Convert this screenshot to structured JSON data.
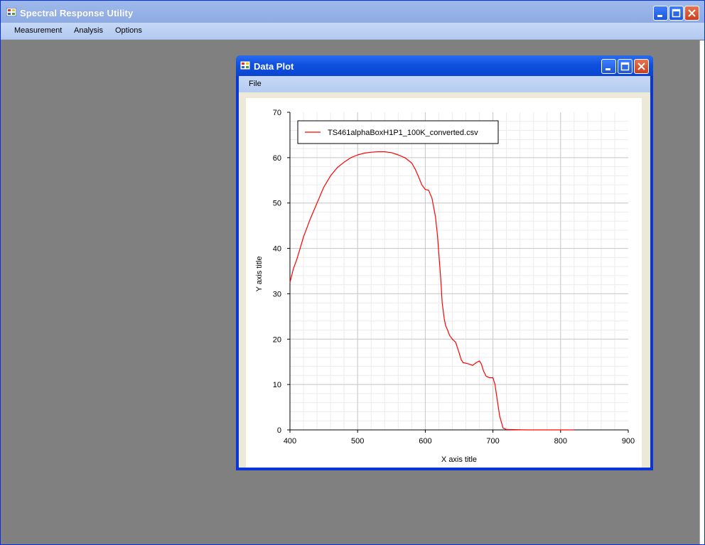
{
  "app": {
    "title": "Spectral Response Utility",
    "menu": [
      "Measurement",
      "Analysis",
      "Options"
    ]
  },
  "child": {
    "title": "Data Plot",
    "menu": [
      "File"
    ]
  },
  "chart_data": {
    "type": "line",
    "xlabel": "X axis title",
    "ylabel": "Y axis title",
    "xlim": [
      400,
      900
    ],
    "ylim": [
      0,
      70
    ],
    "xticks": [
      400,
      500,
      600,
      700,
      800,
      900
    ],
    "yticks": [
      0,
      10,
      20,
      30,
      40,
      50,
      60,
      70
    ],
    "grid": true,
    "legend_position": "top-left",
    "series": [
      {
        "name": "TS461alphaBoxH1P1_100K_converted.csv",
        "color": "#ff0000",
        "x": [
          400,
          405,
          410,
          415,
          420,
          425,
          430,
          440,
          450,
          460,
          470,
          480,
          490,
          500,
          510,
          520,
          530,
          540,
          550,
          560,
          570,
          580,
          585,
          590,
          595,
          600,
          605,
          610,
          615,
          618,
          620,
          623,
          625,
          628,
          630,
          633,
          636,
          640,
          645,
          650,
          653,
          656,
          660,
          665,
          670,
          675,
          680,
          683,
          686,
          690,
          695,
          700,
          703,
          706,
          710,
          715,
          720,
          750,
          800,
          820
        ],
        "y": [
          32.5,
          35.5,
          37.5,
          40,
          42.5,
          44.5,
          46.5,
          50,
          53.5,
          56,
          57.8,
          59,
          60,
          60.6,
          61,
          61.2,
          61.3,
          61.3,
          61.1,
          60.6,
          60,
          58.8,
          57.5,
          55.8,
          54,
          53,
          52.8,
          51,
          47,
          43,
          39,
          33,
          28,
          24.5,
          23,
          22,
          20.8,
          20,
          19.3,
          17,
          15.5,
          14.8,
          14.7,
          14.5,
          14.2,
          14.8,
          15.2,
          14.5,
          13,
          11.8,
          11.5,
          11.5,
          10,
          7,
          3,
          0.4,
          0.1,
          0,
          0,
          0
        ]
      }
    ]
  }
}
